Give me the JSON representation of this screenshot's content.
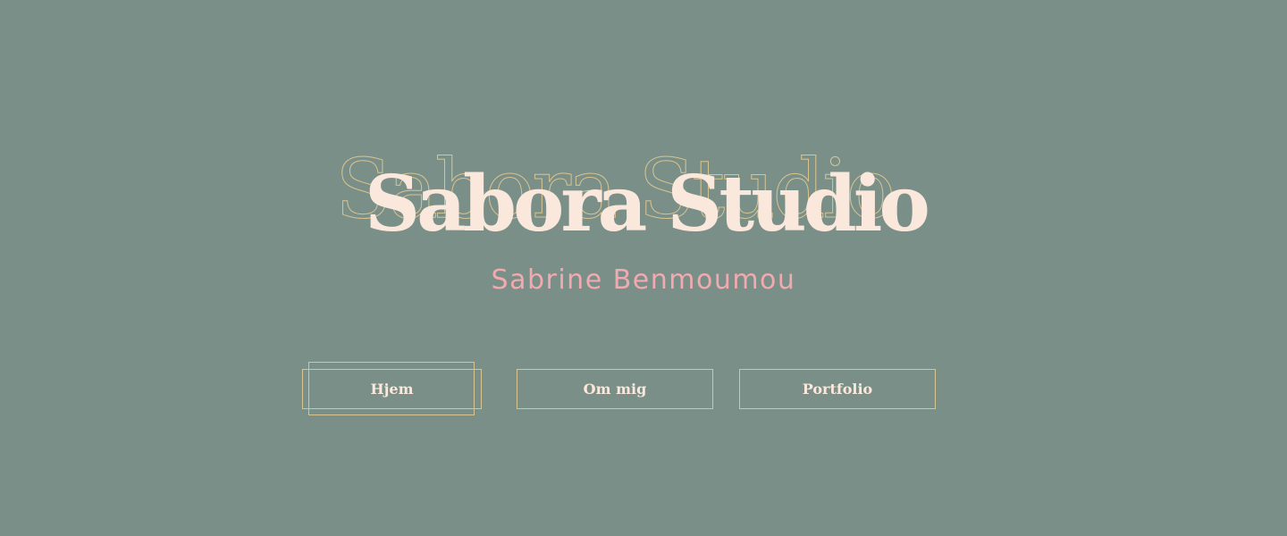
{
  "hero": {
    "title": "Sabora Studio",
    "subtitle": "Sabrine Benmoumou"
  },
  "nav": {
    "items": [
      {
        "label": "Hjem",
        "active": true
      },
      {
        "label": "Om mig",
        "active": false
      },
      {
        "label": "Portfolio",
        "active": false
      }
    ]
  },
  "colors": {
    "background": "#7a8f88",
    "title": "#fbe8dc",
    "outline": "#d8c48f",
    "subtitle": "#f0aab0"
  }
}
